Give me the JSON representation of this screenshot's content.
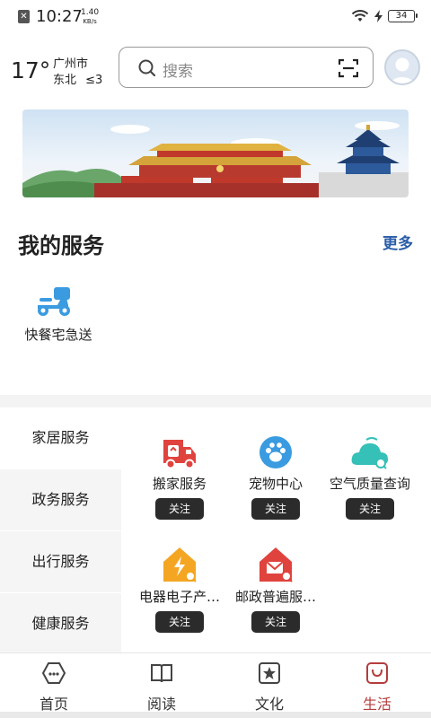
{
  "status_bar": {
    "time": "10:27",
    "speed_value": "1.40",
    "speed_unit": "KB/s",
    "battery": "34"
  },
  "header": {
    "temperature": "17°",
    "city": "广州市",
    "wind_direction": "东北",
    "wind_level": "≤3",
    "search_placeholder": "搜索"
  },
  "my_services": {
    "title": "我的服务",
    "more": "更多",
    "items": [
      {
        "label": "快餐宅急送",
        "icon": "scooter-icon"
      }
    ]
  },
  "categories": [
    {
      "label": "家居服务"
    },
    {
      "label": "政务服务"
    },
    {
      "label": "出行服务"
    },
    {
      "label": "健康服务"
    }
  ],
  "services": [
    {
      "name": "搬家服务",
      "follow": "关注",
      "icon": "moving-truck-icon"
    },
    {
      "name": "宠物中心",
      "follow": "关注",
      "icon": "paw-icon"
    },
    {
      "name": "空气质量查询",
      "follow": "关注",
      "icon": "air-quality-icon"
    },
    {
      "name": "电器电子产…",
      "follow": "关注",
      "icon": "appliance-house-icon"
    },
    {
      "name": "邮政普遍服…",
      "follow": "关注",
      "icon": "postal-house-icon"
    }
  ],
  "bottom_nav": [
    {
      "label": "首页",
      "icon": "home-icon"
    },
    {
      "label": "阅读",
      "icon": "book-icon"
    },
    {
      "label": "文化",
      "icon": "culture-icon"
    },
    {
      "label": "生活",
      "icon": "life-bag-icon"
    }
  ],
  "colors": {
    "accent_link": "#2a5da8",
    "active_nav": "#b43d3d",
    "follow_button": "#2b2b2b",
    "icon_blue": "#3a9be0",
    "icon_red": "#e0433e",
    "icon_orange": "#f4a623",
    "icon_teal": "#35c0b8"
  }
}
